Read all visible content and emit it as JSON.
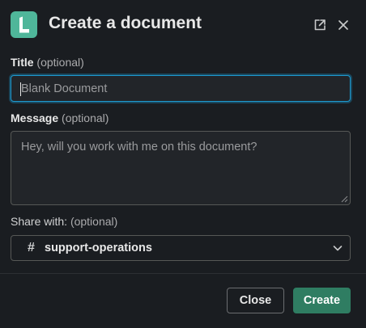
{
  "header": {
    "app_icon": "canvas-app-icon",
    "title": "Create a document",
    "open_external_icon": "open-in-new-window-icon",
    "close_icon": "close-icon"
  },
  "form": {
    "title_field": {
      "label": "Title",
      "optional": "(optional)",
      "value": "",
      "placeholder": "Blank Document"
    },
    "message_field": {
      "label": "Message",
      "optional": "(optional)",
      "value": "",
      "placeholder": "Hey, will you work with me on this document?"
    },
    "share_field": {
      "label": "Share with:",
      "optional": "(optional)",
      "channel_icon": "hash-icon",
      "hash_symbol": "#",
      "selected_channel": "support-operations",
      "dropdown_icon": "chevron-down-icon"
    }
  },
  "footer": {
    "close_label": "Close",
    "create_label": "Create"
  },
  "colors": {
    "background": "#1a1d21",
    "accent_green": "#2f7d62",
    "focus_blue": "#1d9bd1",
    "app_icon_bg": "#4fb69a"
  }
}
